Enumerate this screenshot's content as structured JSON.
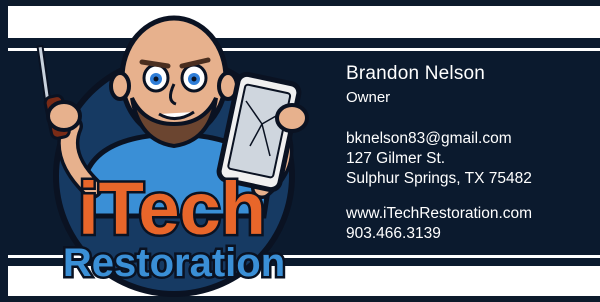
{
  "brand": {
    "logo_text_top": "iTech",
    "logo_text_bottom": "Restoration"
  },
  "contact": {
    "name": "Brandon Nelson",
    "title": "Owner",
    "email": "bknelson83@gmail.com",
    "address_line1": "127 Gilmer St.",
    "address_line2": "Sulphur Springs, TX 75482",
    "website": "www.iTechRestoration.com",
    "phone": "903.466.3139"
  },
  "colors": {
    "band": "#0b1a2e",
    "logo_orange": "#e8662a",
    "logo_blue": "#3a8fd6",
    "text": "#ffffff"
  }
}
